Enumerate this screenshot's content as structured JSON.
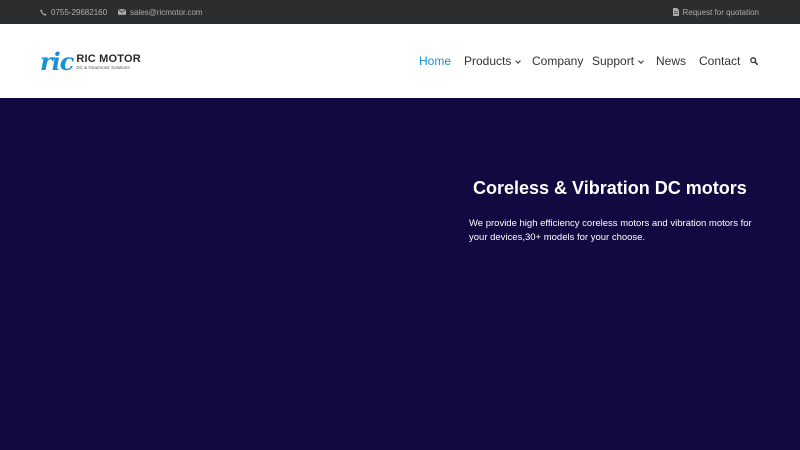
{
  "topbar": {
    "phone": "0755-29682160",
    "email": "sales@ricmotor.com",
    "quote": "Request for quotation"
  },
  "brand": {
    "mark": "ric",
    "name": "RIC MOTOR",
    "tagline": "DC & Gearmotor Solutions",
    "color": "#1a8fd6"
  },
  "nav": {
    "items": [
      {
        "label": "Home",
        "active": true
      },
      {
        "label": "Products",
        "dropdown": true
      },
      {
        "label": "Company"
      },
      {
        "label": "Support",
        "dropdown": true
      },
      {
        "label": "News"
      },
      {
        "label": "Contact"
      }
    ],
    "search_icon": "search-icon"
  },
  "hero": {
    "title": "Coreless & Vibration DC motors",
    "text": "We provide high efficiency coreless motors and vibration motors for your devices,30+ models for your choose.",
    "background": "#11093f"
  },
  "icons": {
    "phone": "phone-icon",
    "email": "envelope-icon",
    "quote": "document-icon"
  }
}
